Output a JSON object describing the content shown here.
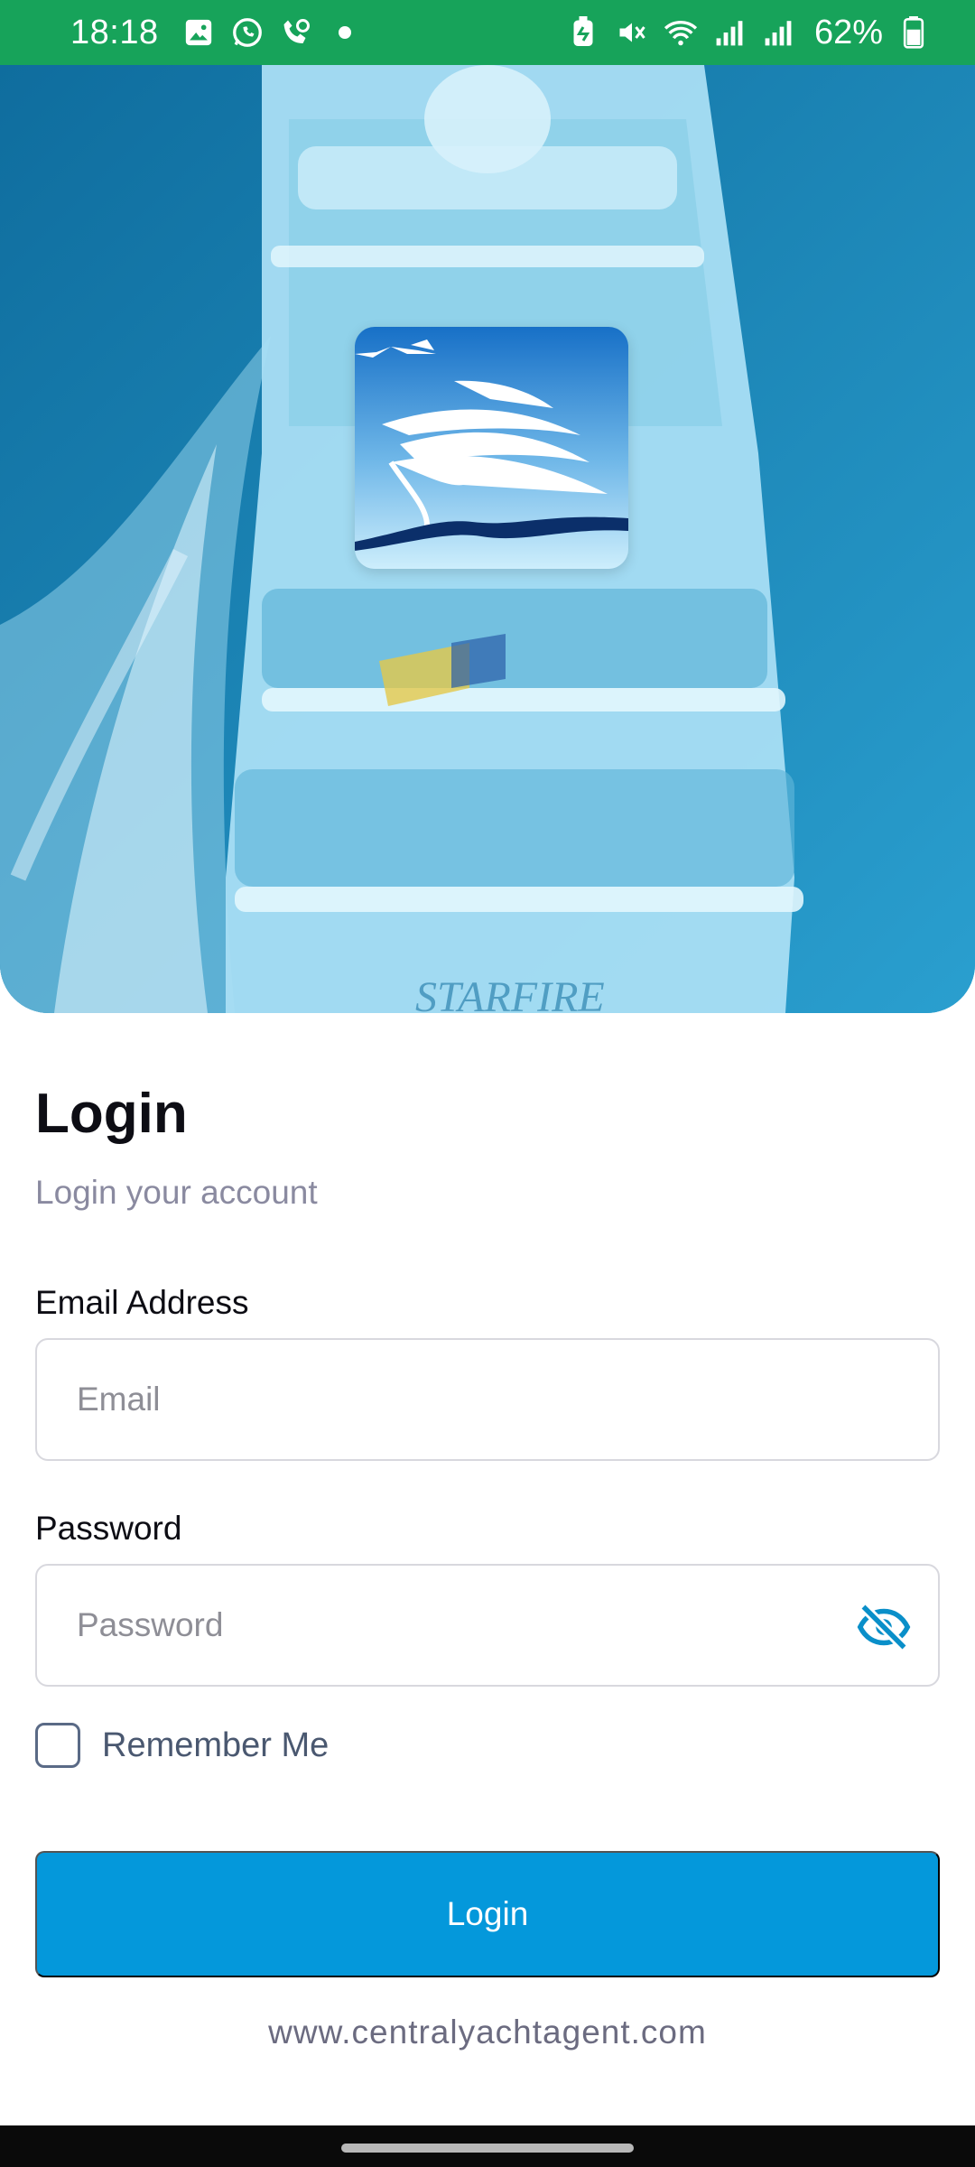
{
  "status_bar": {
    "time": "18:18",
    "battery": "62%",
    "left_icons": [
      "gallery-icon",
      "whatsapp-icon",
      "call-icon",
      "dot-icon"
    ],
    "right_icons": [
      "battery-saver-icon",
      "mute-icon",
      "wifi-icon",
      "signal-icon",
      "signal-icon",
      "battery-icon"
    ]
  },
  "hero": {
    "boat_name": "STARFIRE"
  },
  "login": {
    "title": "Login",
    "subtitle": "Login your account",
    "email_label": "Email Address",
    "email_placeholder": "Email",
    "password_label": "Password",
    "password_placeholder": "Password",
    "remember_label": "Remember Me",
    "remember_checked": false,
    "button_label": "Login",
    "website": "www.centralyachtagent.com"
  },
  "colors": {
    "status_bar": "#17a35a",
    "accent": "#0498db",
    "title_text": "#0d0d14",
    "muted_text": "#8a8aa0"
  }
}
